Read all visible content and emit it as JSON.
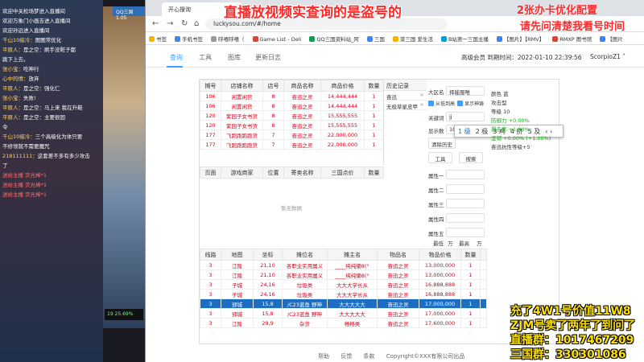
{
  "chat": {
    "messages": [
      {
        "nick": "",
        "text": "欢迎中关松场梦进入直播间",
        "type": "sys"
      },
      {
        "nick": "",
        "text": "欢迎万象门小画吉进入直播间",
        "type": "sys"
      },
      {
        "nick": "",
        "text": "欢迎孙远进入直播间",
        "type": "sys"
      },
      {
        "nick": "千山10级冷：",
        "text": "图图常优化",
        "type": "msg"
      },
      {
        "nick": "平原人：",
        "text": "是之空：刷手没赃子都",
        "type": "msg"
      },
      {
        "nick": "",
        "text": "跳下上去。",
        "type": "msg"
      },
      {
        "nick": "张小宝：",
        "text": "吃神行",
        "type": "msg"
      },
      {
        "nick": "心中的情：",
        "text": "放弃",
        "type": "msg"
      },
      {
        "nick": "平原人：",
        "text": "是之空：强化仁",
        "type": "msg"
      },
      {
        "nick": "张小宝：",
        "text": "失败!",
        "type": "msg"
      },
      {
        "nick": "平原人：",
        "text": "是之空：马上来 我在升鞋",
        "type": "msg"
      },
      {
        "nick": "平原人：",
        "text": "是之空：主要很固",
        "type": "msg"
      },
      {
        "nick": "",
        "text": "令",
        "type": "msg"
      },
      {
        "nick": "千山10级冷：",
        "text": "三个高级化为体只要",
        "type": "msg"
      },
      {
        "nick": "",
        "text": "不修领就不需要魔咒",
        "type": "msg"
      },
      {
        "nick": "218111111：",
        "text": "这套差不多有多少攻击",
        "type": "msg"
      },
      {
        "nick": "",
        "text": "了",
        "type": "msg"
      },
      {
        "nick": "",
        "text": "送给主播 荧光棒*1",
        "type": "gift"
      },
      {
        "nick": "",
        "text": "送给主播 荧光棒*1",
        "type": "gift"
      },
      {
        "nick": "",
        "text": "送给主播 荧光棒*1",
        "type": "gift"
      }
    ]
  },
  "game": {
    "title": "QQ三国1.05",
    "status": "19 25.69%"
  },
  "browser": {
    "tab_label": "开心搜询",
    "url": "luckysou.com/#/home",
    "bookmarks": [
      {
        "label": "书签",
        "color": "#f4b400"
      },
      {
        "label": "手机书签",
        "color": "#4285f4"
      },
      {
        "label": "呼嘻呼嘻（",
        "color": "#999999"
      },
      {
        "label": "Game List - Deli",
        "color": "#db4437"
      },
      {
        "label": "QQ三国资料站_阿",
        "color": "#0f9d58"
      },
      {
        "label": "三国",
        "color": "#4285f4"
      },
      {
        "label": "菜三国 爱生活",
        "color": "#f4b400"
      },
      {
        "label": "B站第一三国主播",
        "color": "#00a1d6"
      },
      {
        "label": "【图片】【RMV】",
        "color": "#3388ff"
      },
      {
        "label": "RMXP 图书馆",
        "color": "#db4437"
      },
      {
        "label": "【图片",
        "color": "#3388ff"
      }
    ]
  },
  "site": {
    "nav": [
      "查询",
      "工具",
      "图库",
      "更新日志"
    ],
    "member": "高级会员 到期时间：2022-01-10 22:39:56",
    "user": "ScorpioZ1 ˅",
    "shop_headers": [
      "摊号",
      "店铺名称",
      "店号",
      "商品名称",
      "商品价格",
      "数量"
    ],
    "shop_rows": [
      [
        "106",
        "闲置闲货",
        "8",
        "奋迅之灵",
        "14,444,444",
        "1"
      ],
      [
        "106",
        "闲置闲货",
        "8",
        "奋迅之灵",
        "14,444,444",
        "1"
      ],
      [
        "120",
        "紫园子女书货",
        "8",
        "奋迅之灵",
        "15,555,555",
        "1"
      ],
      [
        "120",
        "紫园子女书货",
        "8",
        "奋迅之灵",
        "15,555,555",
        "1"
      ],
      [
        "177",
        "飞跑跑跑跑货",
        "7",
        "奋迅之灵",
        "22,000,000",
        "1"
      ],
      [
        "177",
        "飞跑跑跑跑货",
        "7",
        "奋迅之灵",
        "22,000,000",
        "1"
      ]
    ],
    "history": {
      "title": "历史记录",
      "items": [
        "奋迅",
        "无极草星皮甲"
      ]
    },
    "player_headers": [
      "页面",
      "游戏商家",
      "位置",
      "寄卖名称",
      "三国点价",
      "数量"
    ],
    "empty_text": "暂无数据",
    "stall_headers": [
      "线路",
      "地图",
      "坐标",
      "摊位名",
      "摊主名",
      "物品名",
      "物品价格",
      "数量"
    ],
    "stall_rows": [
      [
        "3",
        "江陵",
        "21,10",
        "各职业实用属义",
        "____纯纯懒8(°",
        "奋迅之灵",
        "13,000,000",
        "1"
      ],
      [
        "3",
        "江陵",
        "21,10",
        "各职业实用属义",
        "____纯纯懒8(°",
        "奋迅之灵",
        "13,000,000",
        "1"
      ],
      [
        "3",
        "子城",
        "24,16",
        "垃圾类",
        "大大大学长从",
        "奋迅之灵",
        "16,888,888",
        "1"
      ],
      [
        "3",
        "子城",
        "24,16",
        "垃圾类",
        "大大大学长从",
        "奋迅之灵",
        "16,888,888",
        "1"
      ],
      [
        "3",
        "郢城",
        "15,8",
        "/C23蓝鱼 野神",
        "大大大大大",
        "奋迅之灵",
        "17,000,000",
        "1"
      ],
      [
        "3",
        "郢城",
        "15,8",
        "/C23蓝鱼 野神",
        "大大大大大",
        "奋迅之灵",
        "17,000,000",
        "1"
      ],
      [
        "3",
        "江陵",
        "29,9",
        "杂货",
        "畅畅类",
        "奋迅之灵",
        "17,600,000",
        "1"
      ]
    ],
    "selected_stall_row": 4,
    "filters": {
      "server_label": "大区名",
      "server_value": "择能服唯",
      "check1": "从低到高",
      "check2": "显示神铸",
      "keyword_label": "关键词",
      "keyword_value": "jj",
      "display_label": "显示数",
      "display_value": "100",
      "clear_btn": "清除历史",
      "tool_btn": "工具",
      "search_btn": "搜索",
      "attrs": [
        "属性一",
        "属性二",
        "属性三",
        "属性四",
        "属性五"
      ],
      "min_price": "最低",
      "max_price": "最高",
      "unit": "万"
    },
    "ime": [
      "1 级",
      "2 极",
      "3 鸡",
      "4 挤",
      "5 及"
    ],
    "detail": {
      "color": "颜色 蓝",
      "attack": "攻击型",
      "level": "等级 10",
      "lines": [
        "防御力 +0.00%",
        "暴击率 +1.00%",
        "坚韧 +0.00% (+1.00%)",
        "奋迅抗性等级+5"
      ]
    },
    "footer": [
      "帮助",
      "反馈",
      "条款",
      "Copyright©XXX有限公司出品"
    ]
  },
  "overlays": {
    "top": "直播放视频实查询的是盗号的",
    "top_right_1": "2张办卡优化配置",
    "top_right_2": "请先问清楚我看号时间",
    "bottom_right": [
      "充了4W1号价值11W8",
      "ZJM号卖了两年了到问了",
      "直播群：1017467209",
      "三国群：330301086"
    ]
  }
}
